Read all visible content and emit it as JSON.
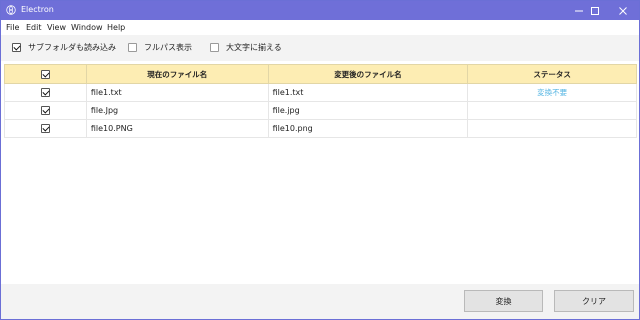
{
  "window": {
    "title": "Electron"
  },
  "menu": [
    "File",
    "Edit",
    "View",
    "Window",
    "Help"
  ],
  "options": [
    {
      "label": "サブフォルダも読み込み",
      "checked": true
    },
    {
      "label": "フルパス表示",
      "checked": false
    },
    {
      "label": "大文字に揃える",
      "checked": false
    }
  ],
  "table": {
    "headers": [
      "現在のファイル名",
      "変更後のファイル名",
      "ステータス"
    ],
    "rows": [
      {
        "checked": true,
        "current": "file1.txt",
        "renamed": "file1.txt",
        "status": "変換不要"
      },
      {
        "checked": true,
        "current": "file.Jpg",
        "renamed": "file.jpg",
        "status": ""
      },
      {
        "checked": true,
        "current": "file10.PNG",
        "renamed": "file10.png",
        "status": ""
      }
    ]
  },
  "buttons": {
    "convert": "変換",
    "clear": "クリア"
  },
  "colors": {
    "titlebar": "#6f6fd8",
    "header_bg": "#fdedb3",
    "status_text": "#57b6e3"
  }
}
